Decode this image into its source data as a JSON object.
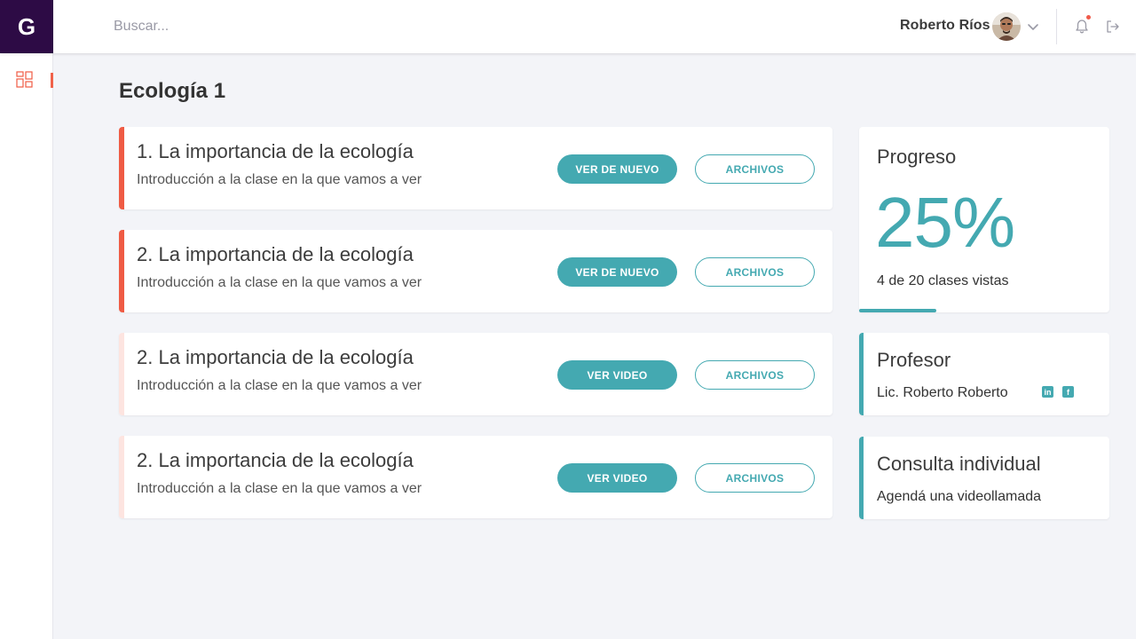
{
  "brand": {
    "logo_letter": "G"
  },
  "search": {
    "placeholder": "Buscar..."
  },
  "user": {
    "name": "Roberto Ríos"
  },
  "page": {
    "title": "Ecología 1"
  },
  "lessons": [
    {
      "title": "1. La importancia de la ecología",
      "subtitle": "Introducción a la clase en la que vamos a ver",
      "status": "done",
      "primary_label": "VER DE NUEVO",
      "files_label": "ARCHIVOS"
    },
    {
      "title": "2. La importancia de la ecología",
      "subtitle": "Introducción a la clase en la que vamos a ver",
      "status": "done",
      "primary_label": "VER DE NUEVO",
      "files_label": "ARCHIVOS"
    },
    {
      "title": "2. La importancia de la ecología",
      "subtitle": "Introducción a la clase en la que vamos a ver",
      "status": "pending",
      "primary_label": "VER VIDEO",
      "files_label": "ARCHIVOS"
    },
    {
      "title": "2. La importancia de la ecología",
      "subtitle": "Introducción a la clase en la que vamos a ver",
      "status": "pending",
      "primary_label": "VER VIDEO",
      "files_label": "ARCHIVOS"
    }
  ],
  "progress": {
    "heading": "Progreso",
    "value": "25%",
    "fraction": 0.25,
    "summary": "4 de 20 clases vistas"
  },
  "teacher": {
    "heading": "Profesor",
    "name": "Lic. Roberto Roberto",
    "social_icons": [
      "linkedin-icon",
      "facebook-icon"
    ]
  },
  "consult": {
    "heading": "Consulta individual",
    "text": "Agendá una videollamada"
  },
  "colors": {
    "brand_dark": "#2d0b45",
    "accent_teal": "#44a9b1",
    "done_red": "#ef5b44",
    "pending_pink": "#fde4e0",
    "notification_dot": "#f05a4a"
  }
}
